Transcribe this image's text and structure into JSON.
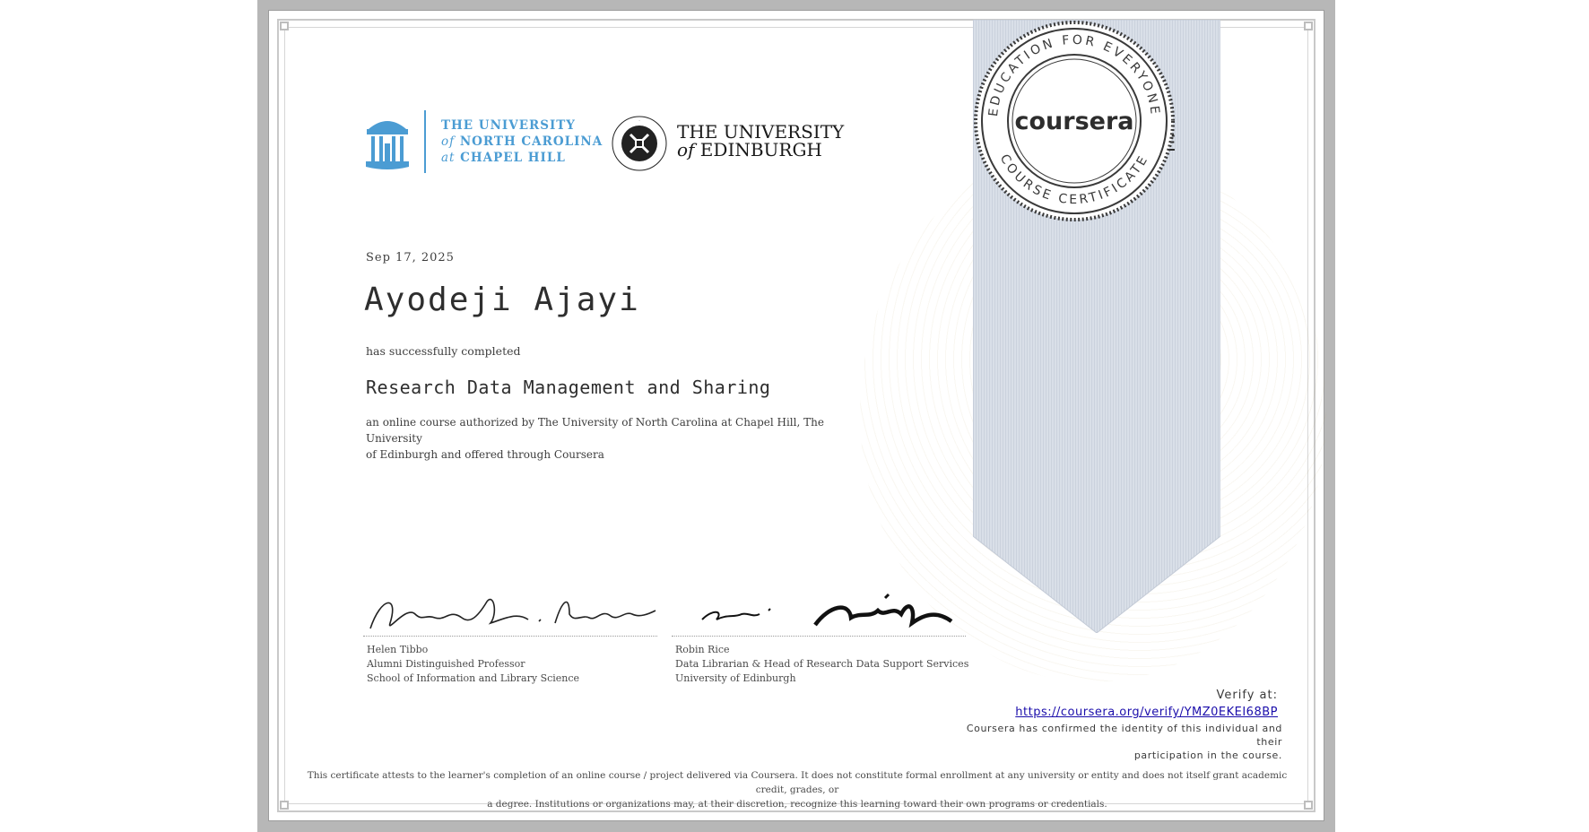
{
  "logos": {
    "unc": {
      "line1": "THE UNIVERSITY",
      "line2_italic": "of",
      "line2": " NORTH CAROLINA",
      "line3_italic": "at",
      "line3": " CHAPEL HILL"
    },
    "edinburgh": {
      "line1": "THE UNIVERSITY",
      "line2_italic": "of",
      "line2": " EDINBURGH"
    }
  },
  "certificate": {
    "date": "Sep 17, 2025",
    "recipient": "Ayodeji Ajayi",
    "completed_text": "has successfully completed",
    "course_title": "Research Data Management and Sharing",
    "authorized_line1": "an online course authorized by The University of North Carolina at Chapel Hill, The University",
    "authorized_line2": "of Edinburgh and offered through Coursera"
  },
  "ribbon": {
    "title_line1": "COURSE",
    "title_line2": "CERTIFICATE",
    "seal_brand": "coursera",
    "seal_ring_top": "EDUCATION FOR EVERYONE",
    "seal_ring_bottom": "COURSE CERTIFICATE"
  },
  "signatories": [
    {
      "name": "Helen Tibbo",
      "title": "Alumni Distinguished Professor",
      "org": "School of Information and Library Science"
    },
    {
      "name": "Robin Rice",
      "title": "Data Librarian & Head of Research Data Support Services",
      "org": "University of Edinburgh"
    }
  ],
  "verify": {
    "label": "Verify at:",
    "url": "https://coursera.org/verify/YMZ0EKEI68BP",
    "confirm_line1": "Coursera has confirmed the identity of this individual and their",
    "confirm_line2": "participation in the course."
  },
  "disclaimer": {
    "line1": "This certificate attests to the learner's completion of an online course / project delivered via Coursera. It does not constitute formal enrollment at any university or entity and does not itself grant academic credit, grades, or",
    "line2": "a degree. Institutions or organizations may, at their discretion, recognize this learning toward their own programs or credentials."
  },
  "colors": {
    "unc_blue": "#4b9cd3",
    "ribbon_fill": "#d7dde6",
    "seal_dark": "#3a3a3a",
    "link": "#1a0dab"
  }
}
